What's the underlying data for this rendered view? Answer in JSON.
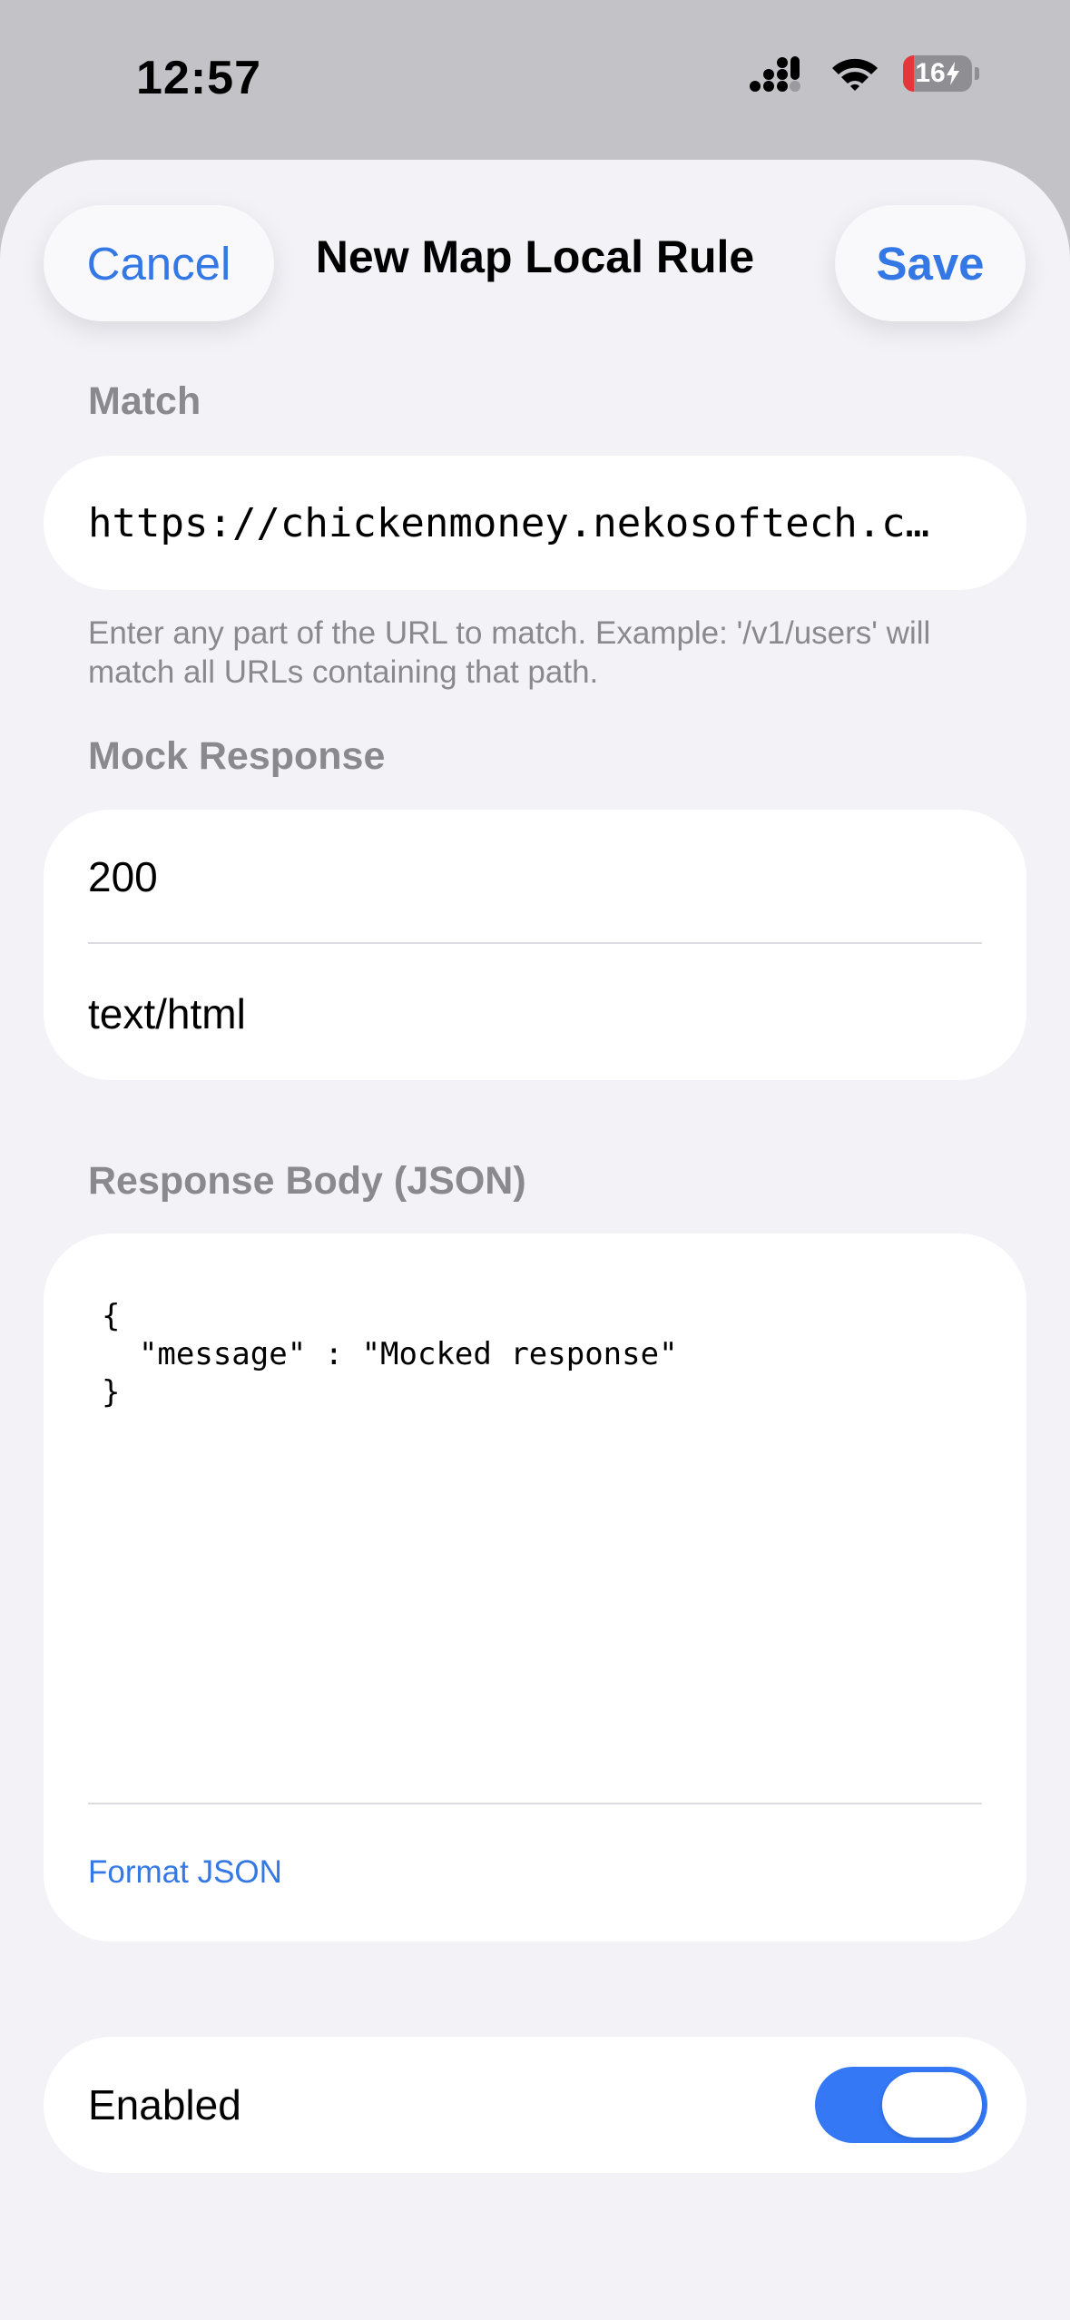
{
  "status_bar": {
    "time": "12:57",
    "battery_level": "16",
    "battery_percent": 16,
    "battery_icon": "charging-bolt-icon",
    "signal_icon": "cellular-signal-icon",
    "wifi_icon": "wifi-icon"
  },
  "nav": {
    "cancel_label": "Cancel",
    "title": "New Map Local Rule",
    "save_label": "Save"
  },
  "match": {
    "header": "Match",
    "url_value": "https://chickenmoney.nekosoftech.c…",
    "hint": "Enter any part of the URL to match. Example: '/v1/users' will match all URLs containing that path."
  },
  "mock_response": {
    "header": "Mock Response",
    "status_code": "200",
    "content_type": "text/html"
  },
  "response_body": {
    "header": "Response Body (JSON)",
    "body": "{\n  \"message\" : \"Mocked response\"\n}",
    "format_label": "Format JSON"
  },
  "enabled": {
    "label": "Enabled",
    "value": true
  },
  "colors": {
    "accent": "#3478e5",
    "toggle_on": "#3478f6",
    "background": "#f2f2f7",
    "battery_low": "#e5363a"
  }
}
